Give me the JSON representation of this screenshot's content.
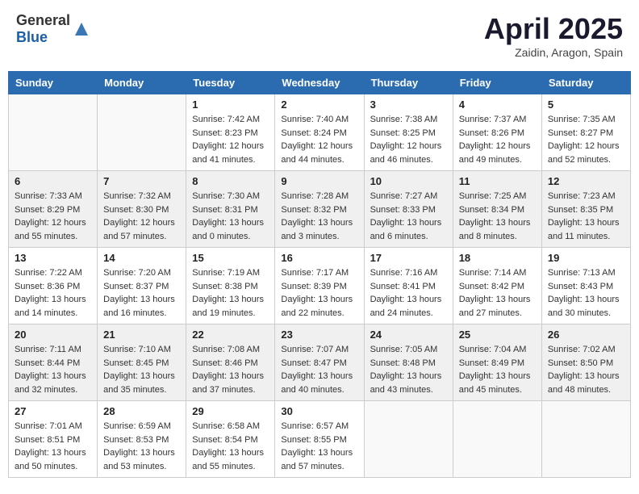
{
  "logo": {
    "general": "General",
    "blue": "Blue"
  },
  "header": {
    "month": "April 2025",
    "location": "Zaidin, Aragon, Spain"
  },
  "weekdays": [
    "Sunday",
    "Monday",
    "Tuesday",
    "Wednesday",
    "Thursday",
    "Friday",
    "Saturday"
  ],
  "weeks": [
    [
      {
        "day": "",
        "info": ""
      },
      {
        "day": "",
        "info": ""
      },
      {
        "day": "1",
        "info": "Sunrise: 7:42 AM\nSunset: 8:23 PM\nDaylight: 12 hours and 41 minutes."
      },
      {
        "day": "2",
        "info": "Sunrise: 7:40 AM\nSunset: 8:24 PM\nDaylight: 12 hours and 44 minutes."
      },
      {
        "day": "3",
        "info": "Sunrise: 7:38 AM\nSunset: 8:25 PM\nDaylight: 12 hours and 46 minutes."
      },
      {
        "day": "4",
        "info": "Sunrise: 7:37 AM\nSunset: 8:26 PM\nDaylight: 12 hours and 49 minutes."
      },
      {
        "day": "5",
        "info": "Sunrise: 7:35 AM\nSunset: 8:27 PM\nDaylight: 12 hours and 52 minutes."
      }
    ],
    [
      {
        "day": "6",
        "info": "Sunrise: 7:33 AM\nSunset: 8:29 PM\nDaylight: 12 hours and 55 minutes."
      },
      {
        "day": "7",
        "info": "Sunrise: 7:32 AM\nSunset: 8:30 PM\nDaylight: 12 hours and 57 minutes."
      },
      {
        "day": "8",
        "info": "Sunrise: 7:30 AM\nSunset: 8:31 PM\nDaylight: 13 hours and 0 minutes."
      },
      {
        "day": "9",
        "info": "Sunrise: 7:28 AM\nSunset: 8:32 PM\nDaylight: 13 hours and 3 minutes."
      },
      {
        "day": "10",
        "info": "Sunrise: 7:27 AM\nSunset: 8:33 PM\nDaylight: 13 hours and 6 minutes."
      },
      {
        "day": "11",
        "info": "Sunrise: 7:25 AM\nSunset: 8:34 PM\nDaylight: 13 hours and 8 minutes."
      },
      {
        "day": "12",
        "info": "Sunrise: 7:23 AM\nSunset: 8:35 PM\nDaylight: 13 hours and 11 minutes."
      }
    ],
    [
      {
        "day": "13",
        "info": "Sunrise: 7:22 AM\nSunset: 8:36 PM\nDaylight: 13 hours and 14 minutes."
      },
      {
        "day": "14",
        "info": "Sunrise: 7:20 AM\nSunset: 8:37 PM\nDaylight: 13 hours and 16 minutes."
      },
      {
        "day": "15",
        "info": "Sunrise: 7:19 AM\nSunset: 8:38 PM\nDaylight: 13 hours and 19 minutes."
      },
      {
        "day": "16",
        "info": "Sunrise: 7:17 AM\nSunset: 8:39 PM\nDaylight: 13 hours and 22 minutes."
      },
      {
        "day": "17",
        "info": "Sunrise: 7:16 AM\nSunset: 8:41 PM\nDaylight: 13 hours and 24 minutes."
      },
      {
        "day": "18",
        "info": "Sunrise: 7:14 AM\nSunset: 8:42 PM\nDaylight: 13 hours and 27 minutes."
      },
      {
        "day": "19",
        "info": "Sunrise: 7:13 AM\nSunset: 8:43 PM\nDaylight: 13 hours and 30 minutes."
      }
    ],
    [
      {
        "day": "20",
        "info": "Sunrise: 7:11 AM\nSunset: 8:44 PM\nDaylight: 13 hours and 32 minutes."
      },
      {
        "day": "21",
        "info": "Sunrise: 7:10 AM\nSunset: 8:45 PM\nDaylight: 13 hours and 35 minutes."
      },
      {
        "day": "22",
        "info": "Sunrise: 7:08 AM\nSunset: 8:46 PM\nDaylight: 13 hours and 37 minutes."
      },
      {
        "day": "23",
        "info": "Sunrise: 7:07 AM\nSunset: 8:47 PM\nDaylight: 13 hours and 40 minutes."
      },
      {
        "day": "24",
        "info": "Sunrise: 7:05 AM\nSunset: 8:48 PM\nDaylight: 13 hours and 43 minutes."
      },
      {
        "day": "25",
        "info": "Sunrise: 7:04 AM\nSunset: 8:49 PM\nDaylight: 13 hours and 45 minutes."
      },
      {
        "day": "26",
        "info": "Sunrise: 7:02 AM\nSunset: 8:50 PM\nDaylight: 13 hours and 48 minutes."
      }
    ],
    [
      {
        "day": "27",
        "info": "Sunrise: 7:01 AM\nSunset: 8:51 PM\nDaylight: 13 hours and 50 minutes."
      },
      {
        "day": "28",
        "info": "Sunrise: 6:59 AM\nSunset: 8:53 PM\nDaylight: 13 hours and 53 minutes."
      },
      {
        "day": "29",
        "info": "Sunrise: 6:58 AM\nSunset: 8:54 PM\nDaylight: 13 hours and 55 minutes."
      },
      {
        "day": "30",
        "info": "Sunrise: 6:57 AM\nSunset: 8:55 PM\nDaylight: 13 hours and 57 minutes."
      },
      {
        "day": "",
        "info": ""
      },
      {
        "day": "",
        "info": ""
      },
      {
        "day": "",
        "info": ""
      }
    ]
  ]
}
